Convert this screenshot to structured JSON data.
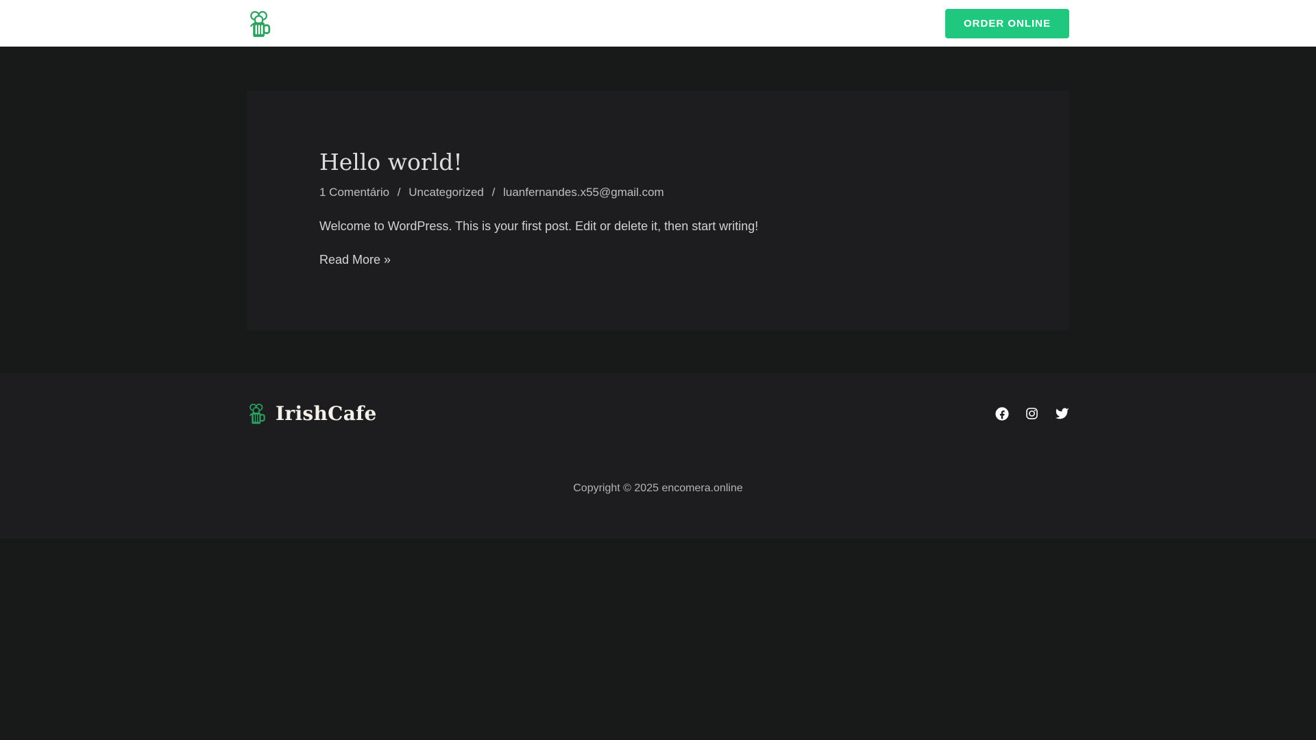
{
  "header": {
    "order_button_label": "ORDER ONLINE",
    "logo_icon": "beer-mug-shamrock-icon"
  },
  "post": {
    "title": "Hello world!",
    "meta": {
      "comments": "1 Comentário",
      "separator": "/",
      "category": "Uncategorized",
      "author": "luanfernandes.x55@gmail.com"
    },
    "excerpt": "Welcome to WordPress. This is your first post. Edit or delete it, then start writing!",
    "read_more_label": "Read More »"
  },
  "footer": {
    "brand": "IrishCafe",
    "social_icons": [
      "facebook-icon",
      "instagram-icon",
      "twitter-icon"
    ],
    "copyright": "Copyright © 2025 encomera.online"
  },
  "colors": {
    "accent_green": "#1fc87e",
    "logo_green": "#2aa25e",
    "header_bg": "#ffffff",
    "page_bg": "#171a19",
    "panel_bg": "#1d1d1f"
  }
}
